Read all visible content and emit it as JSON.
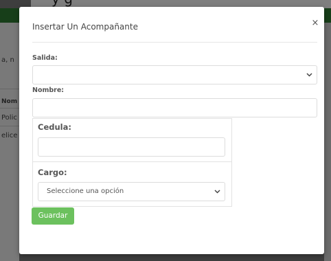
{
  "background_page": {
    "top_text": "y                  g",
    "left_snippet_1": "a, n",
    "left_column_header": "Nom",
    "left_row_1": "Polic",
    "left_row_2": "elice"
  },
  "modal": {
    "title": "Insertar Un Acompañante",
    "close_label": "×",
    "salida": {
      "label": "Salida:",
      "value": ""
    },
    "nombre": {
      "label": "Nombre:",
      "value": ""
    },
    "cedula": {
      "label": "Cedula:",
      "value": ""
    },
    "cargo": {
      "label": "Cargo:",
      "selected": "Seleccione una opción"
    },
    "save_label": "Guardar"
  },
  "colors": {
    "header_green": "#2e7d32",
    "button_green": "#6cc15e"
  },
  "icons": {
    "close": "close-icon",
    "salida_dropdown": "chevron-down-icon",
    "cargo_dropdown": "chevron-down-icon"
  }
}
